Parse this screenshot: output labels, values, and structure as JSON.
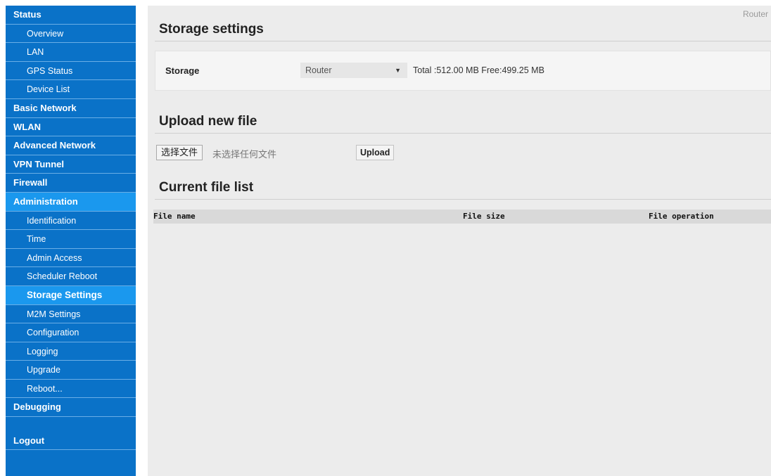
{
  "sidebar": {
    "items": [
      {
        "label": "Status",
        "level": "top"
      },
      {
        "label": "Overview",
        "level": "sub"
      },
      {
        "label": "LAN",
        "level": "sub"
      },
      {
        "label": "GPS Status",
        "level": "sub"
      },
      {
        "label": "Device List",
        "level": "sub"
      },
      {
        "label": "Basic Network",
        "level": "top"
      },
      {
        "label": "WLAN",
        "level": "top"
      },
      {
        "label": "Advanced Network",
        "level": "top"
      },
      {
        "label": "VPN Tunnel",
        "level": "top"
      },
      {
        "label": "Firewall",
        "level": "top"
      },
      {
        "label": "Administration",
        "level": "top"
      },
      {
        "label": "Identification",
        "level": "sub"
      },
      {
        "label": "Time",
        "level": "sub"
      },
      {
        "label": "Admin Access",
        "level": "sub"
      },
      {
        "label": "Scheduler Reboot",
        "level": "sub"
      },
      {
        "label": "Storage Settings",
        "level": "sub"
      },
      {
        "label": "M2M Settings",
        "level": "sub"
      },
      {
        "label": "Configuration",
        "level": "sub"
      },
      {
        "label": "Logging",
        "level": "sub"
      },
      {
        "label": "Upgrade",
        "level": "sub"
      },
      {
        "label": "Reboot...",
        "level": "sub"
      },
      {
        "label": "Debugging",
        "level": "top"
      }
    ],
    "logout_label": "Logout",
    "active_section": "Administration",
    "active_item": "Storage Settings"
  },
  "header": {
    "router_label": "Router"
  },
  "storage_settings": {
    "title": "Storage settings",
    "storage_label": "Storage",
    "storage_select_value": "Router",
    "storage_info": "Total :512.00 MB Free:499.25 MB"
  },
  "upload": {
    "title": "Upload new file",
    "choose_file_label": "选择文件",
    "no_file_text": "未选择任何文件",
    "upload_button_label": "Upload"
  },
  "file_list": {
    "title": "Current file list",
    "columns": [
      "File name",
      "File size",
      "File operation"
    ],
    "rows": []
  },
  "colors": {
    "sidebar_bg": "#0a72c8",
    "sidebar_active_bg": "#1a98ee",
    "main_bg": "#ececec"
  }
}
